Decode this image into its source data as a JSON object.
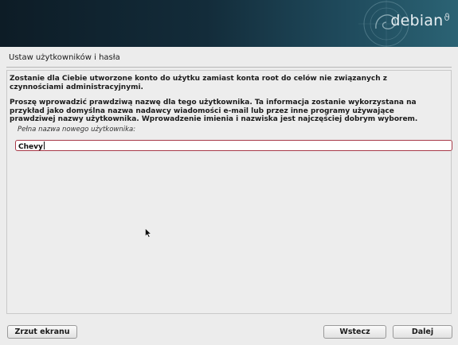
{
  "banner": {
    "brand": "debian",
    "logo_icon": "debian-swirl-icon"
  },
  "page": {
    "title": "Ustaw użytkowników i hasła",
    "para1": "Zostanie dla Ciebie utworzone konto do użytku zamiast konta root do celów nie związanych z czynnościami administracyjnymi.",
    "para2": "Proszę wprowadzić prawdziwą nazwę dla tego użytkownika. Ta informacja zostanie wykorzystana na przykład jako domyślna nazwa nadawcy wiadomości e-mail lub przez inne programy używające prawdziwej nazwy użytkownika. Wprowadzenie imienia i nazwiska jest najczęściej dobrym wyborem.",
    "field_label": "Pełna nazwa nowego użytkownika:",
    "field_value": "Chevy"
  },
  "buttons": {
    "screenshot": "Zrzut ekranu",
    "back": "Wstecz",
    "next": "Dalej"
  },
  "colors": {
    "banner_dark": "#0d1c26",
    "banner_light": "#2b6374",
    "input_border": "#a73a48"
  }
}
